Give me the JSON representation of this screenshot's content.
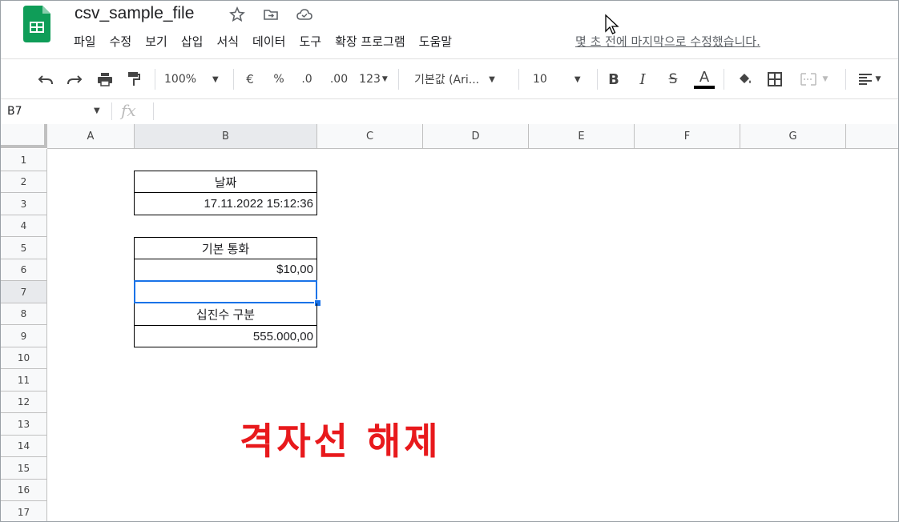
{
  "doc": {
    "title": "csv_sample_file"
  },
  "icons": {
    "logo": "sheets-logo-icon",
    "star": "star-icon",
    "move": "move-to-folder-icon",
    "cloud": "cloud-saved-icon"
  },
  "menu": [
    "파일",
    "수정",
    "보기",
    "삽입",
    "서식",
    "데이터",
    "도구",
    "확장 프로그램",
    "도움말"
  ],
  "last_edit": "몇 초 전에 마지막으로 수정했습니다.",
  "toolbar": {
    "zoom": "100%",
    "currency": "€",
    "percent": "%",
    "dec_decrease": ".0",
    "dec_increase": ".00",
    "more_formats": "123",
    "font": "기본값 (Ari...",
    "font_size": "10",
    "bold": "B",
    "italic": "I",
    "strike": "S",
    "text_color": "A"
  },
  "formula_bar": {
    "name_box": "B7",
    "fx": "fx"
  },
  "columns": [
    "A",
    "B",
    "C",
    "D",
    "E",
    "F",
    "G"
  ],
  "rows": [
    "1",
    "2",
    "3",
    "4",
    "5",
    "6",
    "7",
    "8",
    "9",
    "10",
    "11",
    "12",
    "13",
    "14",
    "15",
    "16",
    "17"
  ],
  "cells": {
    "B2": "날짜",
    "B3": "17.11.2022 15:12:36",
    "B5": "기본 통화",
    "B6": "$10,00",
    "B8": "십진수 구분",
    "B9": "555.000,00"
  },
  "active_cell": "B7",
  "overlay_text": "격자선 해제",
  "colors": {
    "accent": "#1a73e8",
    "overlay": "#e8191c",
    "sheets_green": "#0f9d58"
  }
}
